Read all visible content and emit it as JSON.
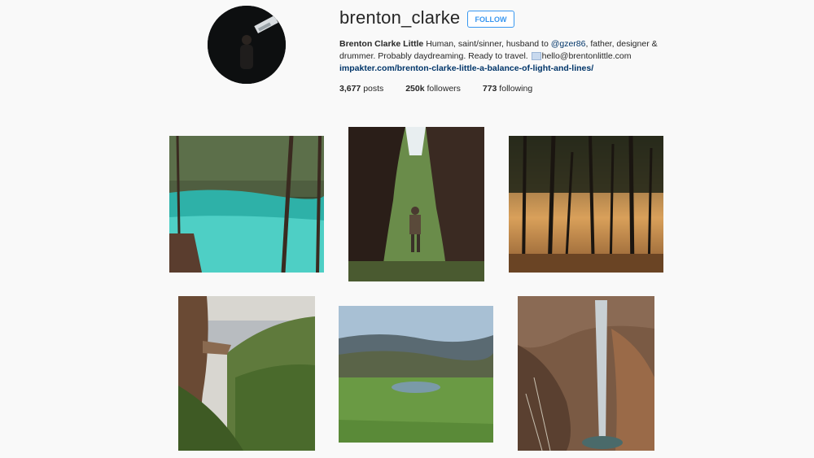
{
  "profile": {
    "username": "brenton_clarke",
    "follow_label": "FOLLOW",
    "full_name": "Brenton Clarke Little",
    "bio_part1": " Human, saint/sinner, husband to ",
    "mention": "@gzer86",
    "bio_part2": ", father, designer & drummer. Probably daydreaming. Ready to travel. ",
    "email": "hello@brentonlittle.com",
    "website": "impakter.com/brenton-clarke-little-a-balance-of-light-and-lines/"
  },
  "stats": {
    "posts_count": "3,677",
    "posts_label": " posts",
    "followers_count": "250k",
    "followers_label": " followers",
    "following_count": "773",
    "following_label": " following"
  },
  "colors": {
    "accent": "#3897f0",
    "link": "#003569"
  },
  "photos": [
    {
      "name": "turquoise-lake"
    },
    {
      "name": "cave-hiker"
    },
    {
      "name": "forest-sunset"
    },
    {
      "name": "cliff-ledge"
    },
    {
      "name": "green-valley-pond"
    },
    {
      "name": "canyon-waterfall"
    }
  ]
}
